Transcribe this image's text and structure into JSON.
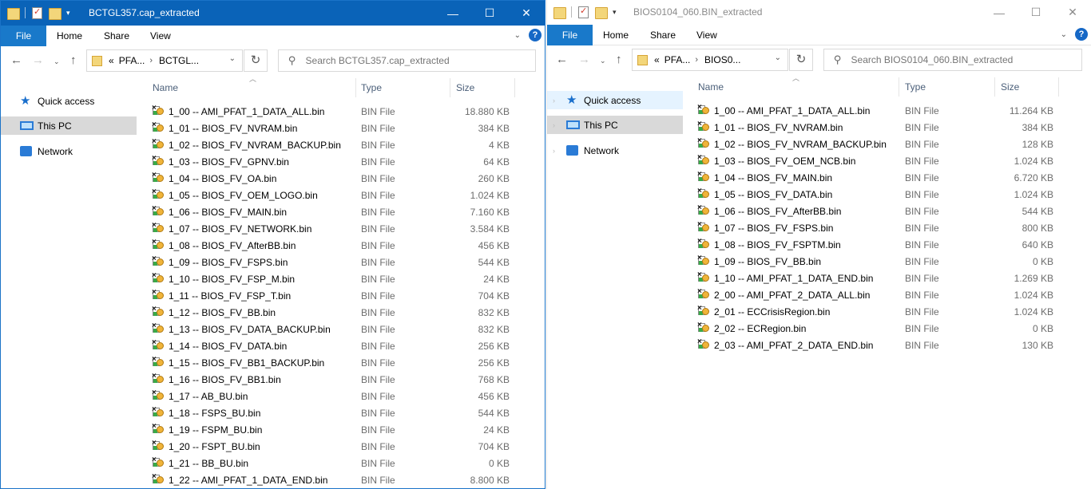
{
  "colors": {
    "titlebar_active": "#0a63b8",
    "file_tab": "#1979ca",
    "selection": "#d9d9d9"
  },
  "left": {
    "title": "BCTGL357.cap_extracted",
    "ribbon": {
      "file": "File",
      "home": "Home",
      "share": "Share",
      "view": "View"
    },
    "address": {
      "prefix": "«",
      "crumb1": "PFA...",
      "sep": "›",
      "crumb2": "BCTGL..."
    },
    "search_placeholder": "Search BCTGL357.cap_extracted",
    "nav": [
      {
        "label": "Quick access",
        "icon": "star-icon"
      },
      {
        "label": "This PC",
        "icon": "computer-icon"
      },
      {
        "label": "Network",
        "icon": "network-icon"
      }
    ],
    "columns": {
      "name": "Name",
      "type": "Type",
      "size": "Size"
    },
    "files": [
      {
        "name": "1_00 -- AMI_PFAT_1_DATA_ALL.bin",
        "type": "BIN File",
        "size": "18.880 KB"
      },
      {
        "name": "1_01 -- BIOS_FV_NVRAM.bin",
        "type": "BIN File",
        "size": "384 KB"
      },
      {
        "name": "1_02 -- BIOS_FV_NVRAM_BACKUP.bin",
        "type": "BIN File",
        "size": "4 KB"
      },
      {
        "name": "1_03 -- BIOS_FV_GPNV.bin",
        "type": "BIN File",
        "size": "64 KB"
      },
      {
        "name": "1_04 -- BIOS_FV_OA.bin",
        "type": "BIN File",
        "size": "260 KB"
      },
      {
        "name": "1_05 -- BIOS_FV_OEM_LOGO.bin",
        "type": "BIN File",
        "size": "1.024 KB"
      },
      {
        "name": "1_06 -- BIOS_FV_MAIN.bin",
        "type": "BIN File",
        "size": "7.160 KB"
      },
      {
        "name": "1_07 -- BIOS_FV_NETWORK.bin",
        "type": "BIN File",
        "size": "3.584 KB"
      },
      {
        "name": "1_08 -- BIOS_FV_AfterBB.bin",
        "type": "BIN File",
        "size": "456 KB"
      },
      {
        "name": "1_09 -- BIOS_FV_FSPS.bin",
        "type": "BIN File",
        "size": "544 KB"
      },
      {
        "name": "1_10 -- BIOS_FV_FSP_M.bin",
        "type": "BIN File",
        "size": "24 KB"
      },
      {
        "name": "1_11 -- BIOS_FV_FSP_T.bin",
        "type": "BIN File",
        "size": "704 KB"
      },
      {
        "name": "1_12 -- BIOS_FV_BB.bin",
        "type": "BIN File",
        "size": "832 KB"
      },
      {
        "name": "1_13 -- BIOS_FV_DATA_BACKUP.bin",
        "type": "BIN File",
        "size": "832 KB"
      },
      {
        "name": "1_14 -- BIOS_FV_DATA.bin",
        "type": "BIN File",
        "size": "256 KB"
      },
      {
        "name": "1_15 -- BIOS_FV_BB1_BACKUP.bin",
        "type": "BIN File",
        "size": "256 KB"
      },
      {
        "name": "1_16 -- BIOS_FV_BB1.bin",
        "type": "BIN File",
        "size": "768 KB"
      },
      {
        "name": "1_17 -- AB_BU.bin",
        "type": "BIN File",
        "size": "456 KB"
      },
      {
        "name": "1_18 -- FSPS_BU.bin",
        "type": "BIN File",
        "size": "544 KB"
      },
      {
        "name": "1_19 -- FSPM_BU.bin",
        "type": "BIN File",
        "size": "24 KB"
      },
      {
        "name": "1_20 -- FSPT_BU.bin",
        "type": "BIN File",
        "size": "704 KB"
      },
      {
        "name": "1_21 -- BB_BU.bin",
        "type": "BIN File",
        "size": "0 KB"
      },
      {
        "name": "1_22 -- AMI_PFAT_1_DATA_END.bin",
        "type": "BIN File",
        "size": "8.800 KB"
      }
    ]
  },
  "right": {
    "title": "BIOS0104_060.BIN_extracted",
    "ribbon": {
      "file": "File",
      "home": "Home",
      "share": "Share",
      "view": "View"
    },
    "address": {
      "prefix": "«",
      "crumb1": "PFA...",
      "sep": "›",
      "crumb2": "BIOS0..."
    },
    "search_placeholder": "Search BIOS0104_060.BIN_extracted",
    "nav": [
      {
        "label": "Quick access",
        "icon": "star-icon"
      },
      {
        "label": "This PC",
        "icon": "computer-icon"
      },
      {
        "label": "Network",
        "icon": "network-icon"
      }
    ],
    "columns": {
      "name": "Name",
      "type": "Type",
      "size": "Size"
    },
    "files": [
      {
        "name": "1_00 -- AMI_PFAT_1_DATA_ALL.bin",
        "type": "BIN File",
        "size": "11.264 KB"
      },
      {
        "name": "1_01 -- BIOS_FV_NVRAM.bin",
        "type": "BIN File",
        "size": "384 KB"
      },
      {
        "name": "1_02 -- BIOS_FV_NVRAM_BACKUP.bin",
        "type": "BIN File",
        "size": "128 KB"
      },
      {
        "name": "1_03 -- BIOS_FV_OEM_NCB.bin",
        "type": "BIN File",
        "size": "1.024 KB"
      },
      {
        "name": "1_04 -- BIOS_FV_MAIN.bin",
        "type": "BIN File",
        "size": "6.720 KB"
      },
      {
        "name": "1_05 -- BIOS_FV_DATA.bin",
        "type": "BIN File",
        "size": "1.024 KB"
      },
      {
        "name": "1_06 -- BIOS_FV_AfterBB.bin",
        "type": "BIN File",
        "size": "544 KB"
      },
      {
        "name": "1_07 -- BIOS_FV_FSPS.bin",
        "type": "BIN File",
        "size": "800 KB"
      },
      {
        "name": "1_08 -- BIOS_FV_FSPTM.bin",
        "type": "BIN File",
        "size": "640 KB"
      },
      {
        "name": "1_09 -- BIOS_FV_BB.bin",
        "type": "BIN File",
        "size": "0 KB"
      },
      {
        "name": "1_10 -- AMI_PFAT_1_DATA_END.bin",
        "type": "BIN File",
        "size": "1.269 KB"
      },
      {
        "name": "2_00 -- AMI_PFAT_2_DATA_ALL.bin",
        "type": "BIN File",
        "size": "1.024 KB"
      },
      {
        "name": "2_01 -- ECCrisisRegion.bin",
        "type": "BIN File",
        "size": "1.024 KB"
      },
      {
        "name": "2_02 -- ECRegion.bin",
        "type": "BIN File",
        "size": "0 KB"
      },
      {
        "name": "2_03 -- AMI_PFAT_2_DATA_END.bin",
        "type": "BIN File",
        "size": "130 KB"
      }
    ]
  }
}
